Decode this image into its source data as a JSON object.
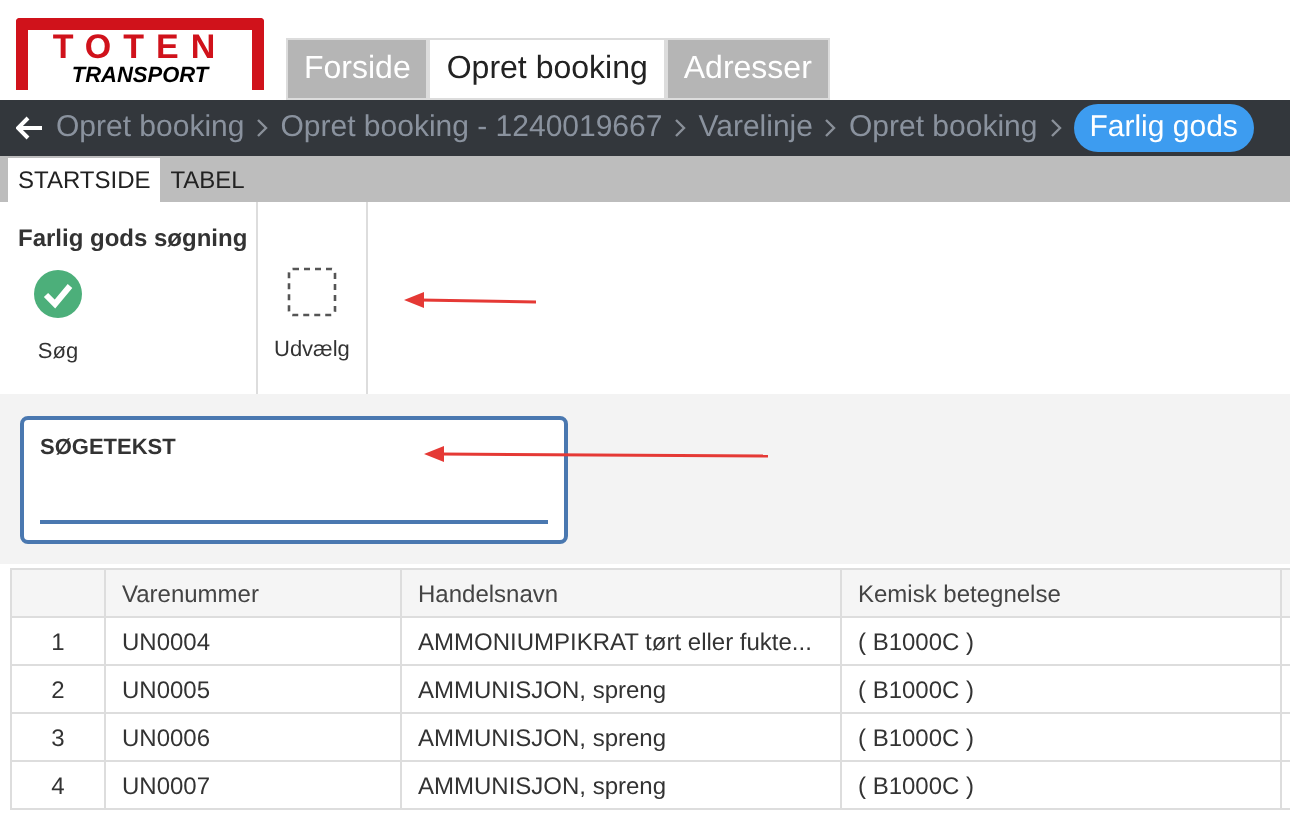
{
  "logo": {
    "line_1": "TOTEN",
    "line_2": "TRANSPORT"
  },
  "tabs": [
    {
      "label": "Forside",
      "selected": false
    },
    {
      "label": "Opret booking",
      "selected": true
    },
    {
      "label": "Adresser",
      "selected": false
    }
  ],
  "breadcrumbs": [
    {
      "label": "Opret booking",
      "selected": false
    },
    {
      "label": "Opret booking - 1240019667",
      "selected": false
    },
    {
      "label": "Varelinje",
      "selected": false
    },
    {
      "label": "Opret booking",
      "selected": false
    },
    {
      "label": "Farlig gods",
      "selected": true
    }
  ],
  "ribbon_tabs": [
    {
      "label": "STARTSIDE",
      "selected": true
    },
    {
      "label": "TABEL",
      "selected": false
    }
  ],
  "ribbon": {
    "title": "Farlig gods søgning",
    "buttons": [
      {
        "kind": "search",
        "label": "Søg"
      },
      {
        "kind": "select",
        "label": "Udvælg"
      }
    ]
  },
  "search_field": {
    "label": "SØGETEKST"
  },
  "table": {
    "columns": [
      "",
      "Varenummer",
      "Handelsnavn",
      "Kemisk betegnelse"
    ],
    "rows": [
      [
        "1",
        "UN0004",
        "AMMONIUMPIKRAT tørt eller fukte...",
        "( B1000C )"
      ],
      [
        "2",
        "UN0005",
        "AMMUNISJON, spreng",
        "( B1000C )"
      ],
      [
        "3",
        "UN0006",
        "AMMUNISJON, spreng",
        "( B1000C )"
      ],
      [
        "4",
        "UN0007",
        "AMMUNISJON, spreng",
        "( B1000C )"
      ]
    ]
  }
}
